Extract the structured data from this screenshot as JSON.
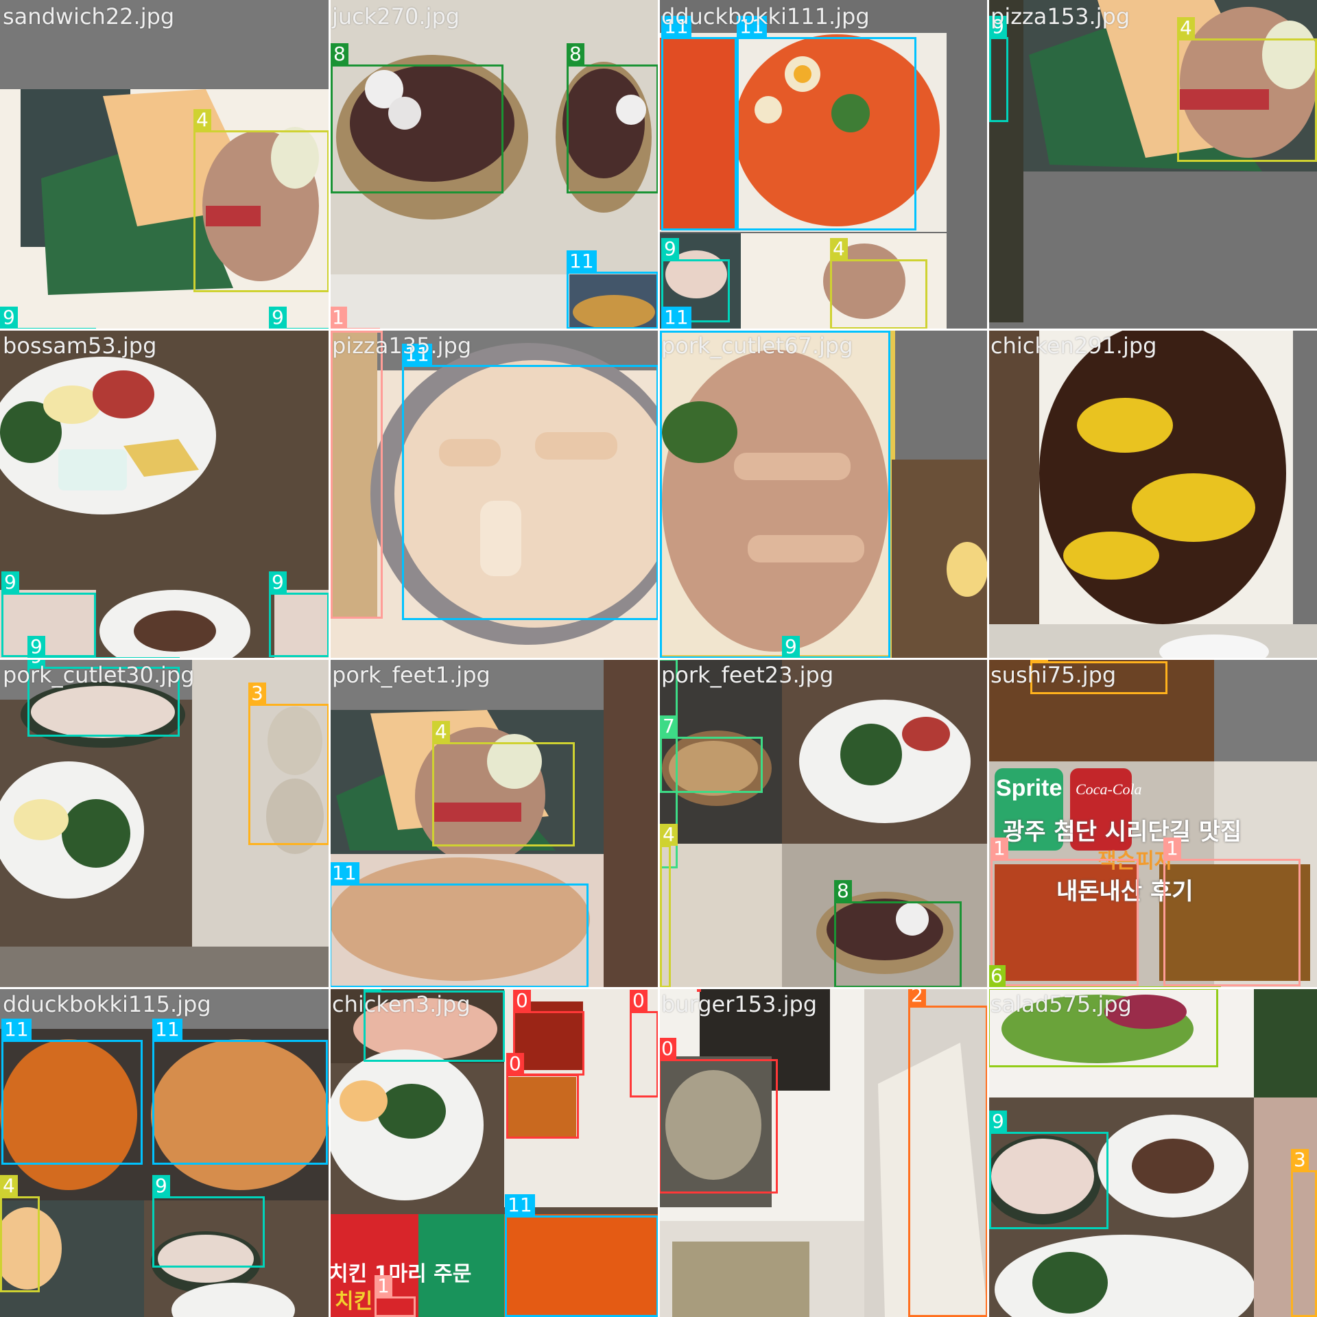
{
  "mosaic": {
    "tiles": [
      {
        "id": "t0",
        "filename": "sandwich22.jpg"
      },
      {
        "id": "t1",
        "filename": "juck270.jpg"
      },
      {
        "id": "t2",
        "filename": "dduckbokki111.jpg"
      },
      {
        "id": "t3",
        "filename": "pizza153.jpg"
      },
      {
        "id": "t4",
        "filename": "bossam53.jpg"
      },
      {
        "id": "t5",
        "filename": "pizza135.jpg"
      },
      {
        "id": "t6",
        "filename": "pork_cutlet67.jpg"
      },
      {
        "id": "t7",
        "filename": "chicken291.jpg"
      },
      {
        "id": "t8",
        "filename": "pork_cutlet30.jpg"
      },
      {
        "id": "t9",
        "filename": "pork_feet1.jpg"
      },
      {
        "id": "t10",
        "filename": "pork_feet23.jpg"
      },
      {
        "id": "t11",
        "filename": "sushi75.jpg"
      },
      {
        "id": "t12",
        "filename": "dduckbokki115.jpg"
      },
      {
        "id": "t13",
        "filename": "chicken3.jpg"
      },
      {
        "id": "t14",
        "filename": "burger153.jpg"
      },
      {
        "id": "t15",
        "filename": "salad575.jpg"
      }
    ],
    "box_colors": {
      "0": "#ff3838",
      "1": "#ff9d97",
      "2": "#ff701f",
      "3": "#ffb21d",
      "4": "#cfd231",
      "6": "#92cc17",
      "7": "#3ddb86",
      "8": "#1a9334",
      "9": "#00d4bb",
      "11": "#00c2ff"
    },
    "labels": {
      "l0": "4",
      "l1": "9",
      "l2": "9",
      "l3": "8",
      "l4": "8",
      "l5": "11",
      "l6": "1",
      "l7": "11",
      "l8": "11",
      "l9": "9",
      "l10": "4",
      "l11": "11",
      "l12": "9",
      "l13": "4",
      "l14": "9",
      "l15": "9",
      "l16": "9",
      "l17": "11",
      "l18": "9",
      "l19": "9",
      "l20": "3",
      "l21": "4",
      "l22": "11",
      "l23": "7",
      "l24": "7",
      "l25": "4",
      "l26": "8",
      "l27": "3",
      "l28": "1",
      "l29": "1",
      "l30": "6",
      "l31": "11",
      "l32": "11",
      "l33": "4",
      "l34": "9",
      "l35": "9",
      "l36": "0",
      "l37": "0",
      "l38": "0",
      "l39": "11",
      "l40": "1",
      "l41": "0",
      "l42": "0",
      "l43": "2",
      "l44": "9",
      "l45": "3"
    },
    "overlay_text": {
      "sign_line1": "광주 첨단 시리단길 맛집",
      "sign_line2": "잭슨피자",
      "sign_line3": "내돈내산 후기",
      "can_left": "Sprite",
      "can_right": "Coca-Cola",
      "poster_chicken": "치킨 1마리 주문",
      "poster_chicken2": "치킨"
    }
  }
}
